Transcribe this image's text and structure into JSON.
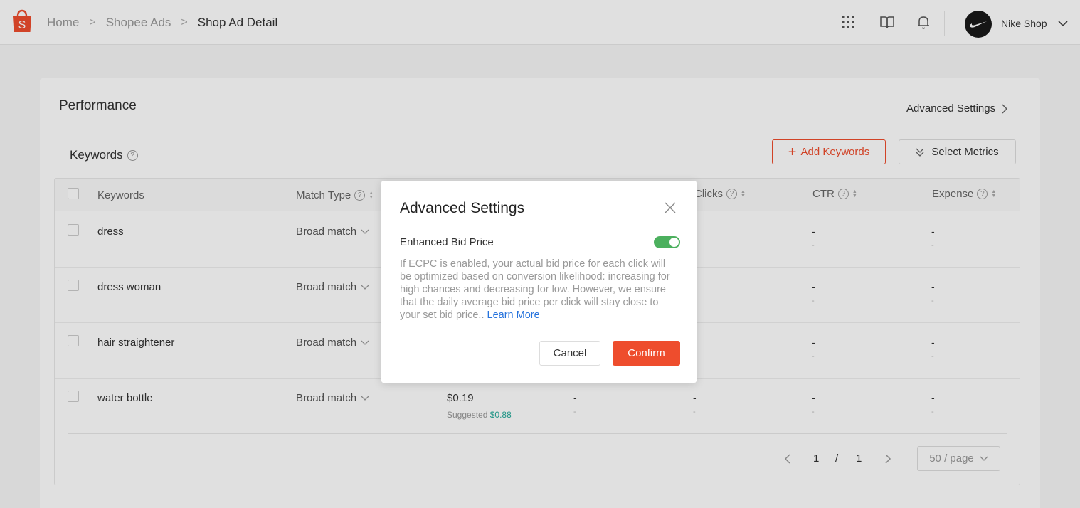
{
  "header": {
    "breadcrumbs": [
      "Home",
      "Shopee Ads",
      "Shop Ad Detail"
    ],
    "shop_name": "Nike Shop",
    "icons": [
      "apps-grid-icon",
      "book-icon",
      "bell-icon",
      "chevron-down-icon"
    ]
  },
  "performance": {
    "title": "Performance",
    "advanced_settings_link": "Advanced Settings"
  },
  "keywords": {
    "title": "Keywords",
    "add_button": "Add Keywords",
    "metrics_button": "Select Metrics",
    "columns": [
      "Keywords",
      "Match Type",
      "Clicks",
      "CTR",
      "Expense"
    ],
    "rows": [
      {
        "keyword": "dress",
        "match": "Broad match"
      },
      {
        "keyword": "dress woman",
        "match": "Broad match"
      },
      {
        "keyword": "hair straightener",
        "match": "Broad match"
      },
      {
        "keyword": "water bottle",
        "match": "Broad match",
        "bid": "$0.19",
        "suggested_label": "Suggested",
        "suggested_value": "$0.88"
      }
    ],
    "dash": "-",
    "pagination": {
      "current": "1",
      "separator": "/",
      "total": "1",
      "page_size": "50 / page"
    }
  },
  "modal": {
    "title": "Advanced Settings",
    "toggle_label": "Enhanced Bid Price",
    "toggle_on": true,
    "description": "If ECPC is enabled, your actual bid price for each click will be optimized based on conversion likelihood: increasing for high chances and decreasing for low. However, we ensure that the daily average bid price per click will stay close to your set bid price..",
    "learn_more": "Learn More",
    "cancel": "Cancel",
    "confirm": "Confirm"
  },
  "colors": {
    "brand": "#ee4d2d",
    "toggle_on": "#4cb05e",
    "link": "#2673dd",
    "suggested": "#26aa99"
  }
}
